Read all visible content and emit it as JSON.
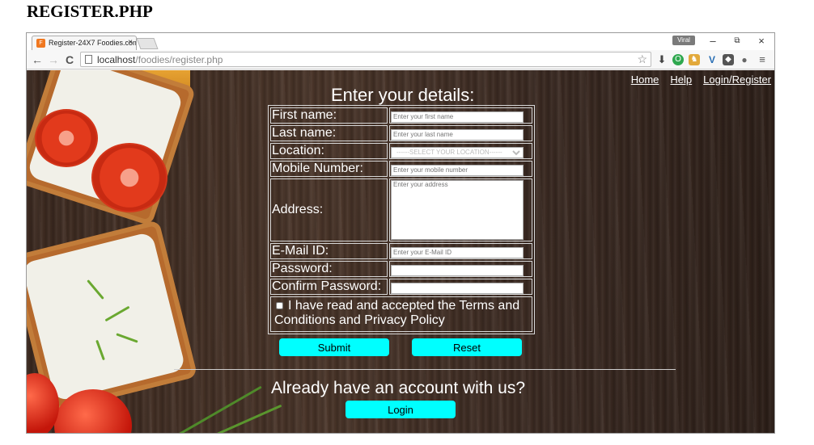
{
  "document": {
    "heading": "REGISTER.PHP"
  },
  "browser": {
    "tab_title": "Register-24X7 Foodies.com",
    "favicon": "F",
    "tab_close": "×",
    "user_badge": "Viral",
    "url_host": "localhost",
    "url_path": "/foodies/register.php",
    "window_controls": {
      "minimize": "–",
      "restore": "⧉",
      "close": "×"
    },
    "nav": {
      "back": "←",
      "forward": "→",
      "reload": "C"
    },
    "icons": [
      "star-icon",
      "download-icon",
      "opera-icon",
      "extension-icon",
      "vimeo-icon",
      "shield-icon",
      "bulb-icon",
      "menu-icon"
    ]
  },
  "page": {
    "nav_links": [
      "Home",
      "Help",
      "Login/Register"
    ],
    "form_title": "Enter your details:",
    "fields": {
      "first_name": {
        "label": "First name:",
        "placeholder": "Enter your first name"
      },
      "last_name": {
        "label": "Last name:",
        "placeholder": "Enter your last name"
      },
      "location": {
        "label": "Location:",
        "selected": "------SELECT YOUR LOCATION------"
      },
      "mobile": {
        "label": "Mobile Number:",
        "placeholder": "Enter your mobile number"
      },
      "address": {
        "label": "Address:",
        "placeholder": "Enter your address"
      },
      "email": {
        "label": "E-Mail ID:",
        "placeholder": "Enter your E-Mail ID"
      },
      "password": {
        "label": "Password:"
      },
      "confirm_password": {
        "label": "Confirm Password:"
      }
    },
    "terms_text": "I have read and accepted the Terms and Conditions and Privacy Policy",
    "submit_label": "Submit",
    "reset_label": "Reset",
    "already_text": "Already have an account with us?",
    "login_label": "Login",
    "colors": {
      "button": "#00ffff",
      "text": "#ffffff"
    }
  }
}
